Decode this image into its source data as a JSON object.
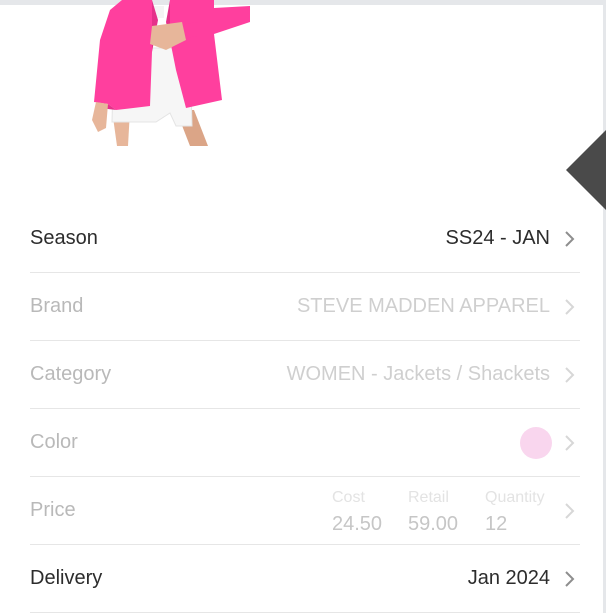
{
  "colors": {
    "blazer": "#ff3f9e",
    "color_swatch": "#f9d6ee",
    "chevron_active": "#8e8e8e",
    "chevron_muted": "#d7d7d7"
  },
  "rows": {
    "season": {
      "label": "Season",
      "value": "SS24 - JAN"
    },
    "brand": {
      "label": "Brand",
      "value": "STEVE MADDEN APPAREL"
    },
    "category": {
      "label": "Category",
      "value": "WOMEN - Jackets / Shackets"
    },
    "color": {
      "label": "Color"
    },
    "price": {
      "label": "Price",
      "cost_header": "Cost",
      "cost_value": "24.50",
      "retail_header": "Retail",
      "retail_value": "59.00",
      "quantity_header": "Quantity",
      "quantity_value": "12"
    },
    "delivery": {
      "label": "Delivery",
      "value": "Jan 2024"
    }
  },
  "icons": {
    "row_chevron": "chevron-right-icon",
    "next_arrow": "triangle-left-icon"
  }
}
